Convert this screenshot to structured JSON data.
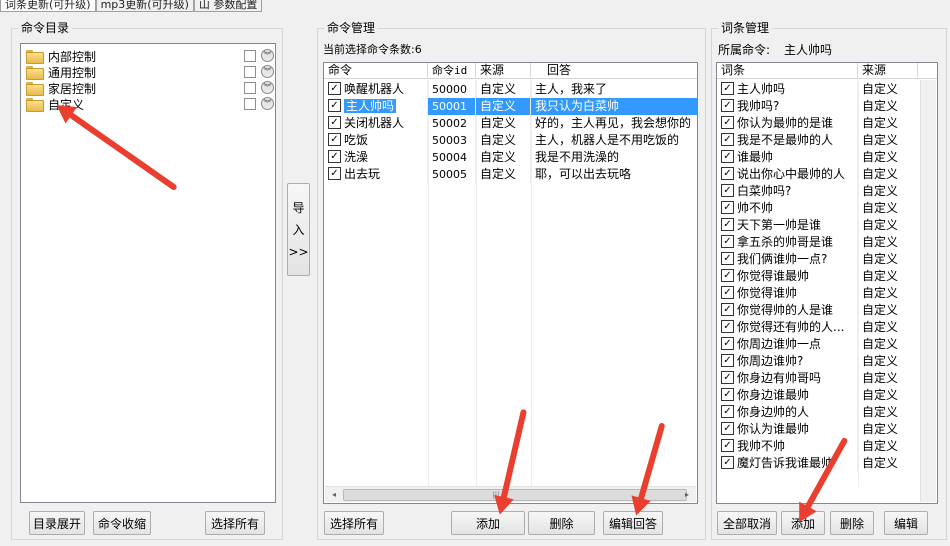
{
  "tabs": [
    "词条更新(可升级)",
    "mp3更新(可升级)",
    "山 参数配置"
  ],
  "command_dir": {
    "title": "命令目录",
    "items": [
      "内部控制",
      "通用控制",
      "家居控制",
      "自定义"
    ],
    "buttons": {
      "expand": "目录展开",
      "collapse": "命令收缩",
      "select_all": "选择所有"
    }
  },
  "import_button": {
    "line1": "导",
    "line2": "入",
    "line3": ">>"
  },
  "command_mgmt": {
    "title": "命令管理",
    "count_label": "当前选择命令条数:6",
    "columns": [
      "命令",
      "命令id",
      "来源",
      "回答"
    ],
    "rows": [
      {
        "cmd": "唤醒机器人",
        "id": "50000",
        "src": "自定义",
        "ans": "主人，我来了"
      },
      {
        "cmd": "主人帅吗",
        "id": "50001",
        "src": "自定义",
        "ans": "我只认为白菜帅"
      },
      {
        "cmd": "关闭机器人",
        "id": "50002",
        "src": "自定义",
        "ans": "好的，主人再见，我会想你的"
      },
      {
        "cmd": "吃饭",
        "id": "50003",
        "src": "自定义",
        "ans": "主人，机器人是不用吃饭的"
      },
      {
        "cmd": "洗澡",
        "id": "50004",
        "src": "自定义",
        "ans": "我是不用洗澡的"
      },
      {
        "cmd": "出去玩",
        "id": "50005",
        "src": "自定义",
        "ans": "耶，可以出去玩咯"
      }
    ],
    "selected_row": 1,
    "buttons": {
      "select_all": "选择所有",
      "add": "添加",
      "delete": "删除",
      "edit_answer": "编辑回答"
    }
  },
  "entry_mgmt": {
    "title": "词条管理",
    "owner_label": "所属命令:",
    "owner_value": "主人帅吗",
    "columns": [
      "词条",
      "来源"
    ],
    "rows": [
      {
        "entry": "主人帅吗",
        "src": "自定义"
      },
      {
        "entry": "我帅吗?",
        "src": "自定义"
      },
      {
        "entry": "你认为最帅的是谁",
        "src": "自定义"
      },
      {
        "entry": "我是不是最帅的人",
        "src": "自定义"
      },
      {
        "entry": "谁最帅",
        "src": "自定义"
      },
      {
        "entry": "说出你心中最帅的人",
        "src": "自定义"
      },
      {
        "entry": "白菜帅吗?",
        "src": "自定义"
      },
      {
        "entry": "帅不帅",
        "src": "自定义"
      },
      {
        "entry": "天下第一帅是谁",
        "src": "自定义"
      },
      {
        "entry": "拿五杀的帅哥是谁",
        "src": "自定义"
      },
      {
        "entry": "我们俩谁帅一点?",
        "src": "自定义"
      },
      {
        "entry": "你觉得谁最帅",
        "src": "自定义"
      },
      {
        "entry": "你觉得谁帅",
        "src": "自定义"
      },
      {
        "entry": "你觉得帅的人是谁",
        "src": "自定义"
      },
      {
        "entry": "你觉得还有帅的人...",
        "src": "自定义"
      },
      {
        "entry": "你周边谁帅一点",
        "src": "自定义"
      },
      {
        "entry": "你周边谁帅?",
        "src": "自定义"
      },
      {
        "entry": "你身边有帅哥吗",
        "src": "自定义"
      },
      {
        "entry": "你身边谁最帅",
        "src": "自定义"
      },
      {
        "entry": "你身边帅的人",
        "src": "自定义"
      },
      {
        "entry": "你认为谁最帅",
        "src": "自定义"
      },
      {
        "entry": "我帅不帅",
        "src": "自定义"
      },
      {
        "entry": "魔灯告诉我谁最帅",
        "src": "自定义"
      }
    ],
    "buttons": {
      "cancel_all": "全部取消",
      "add": "添加",
      "delete": "删除",
      "edit": "编辑"
    }
  },
  "check_mark": "✓",
  "scroll_arrows": {
    "left": "◂",
    "right": "▸",
    "grip": "|||"
  },
  "chevron_glyph": "︾"
}
